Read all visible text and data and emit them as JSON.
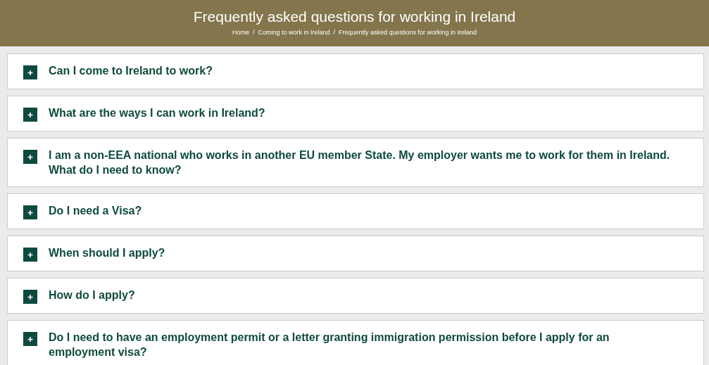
{
  "header": {
    "title": "Frequently asked questions for working in Ireland",
    "breadcrumb_separator": "/",
    "breadcrumb": [
      "Home",
      "Coming to work in Ireland",
      "Frequently asked questions for working in Ireland"
    ]
  },
  "faq": [
    {
      "question": "Can I come to Ireland to work?",
      "expanded": false
    },
    {
      "question": "What are the ways I can work in Ireland?",
      "expanded": false
    },
    {
      "question": "I am a non-EEA national who works in another EU member State. My employer wants me to work for them in Ireland. What do I need to know?",
      "expanded": false
    },
    {
      "question": "Do I need a Visa?",
      "expanded": false
    },
    {
      "question": "When should I apply?",
      "expanded": false
    },
    {
      "question": "How do I apply?",
      "expanded": false
    },
    {
      "question": "Do I need to have an employment permit or a letter granting immigration permission before I apply for an employment visa?",
      "expanded": false
    }
  ]
}
